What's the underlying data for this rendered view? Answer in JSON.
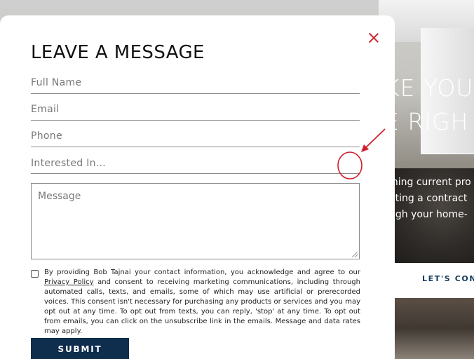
{
  "background": {
    "heading_line1": "KE YOU",
    "heading_line2": "E RIGH",
    "para_line1": "ining current pro",
    "para_line2": "ating a contract",
    "para_line3": "ugh your home-",
    "cta_link": "LET'S CONN"
  },
  "modal": {
    "title": "LEAVE A MESSAGE",
    "fields": {
      "full_name_placeholder": "Full Name",
      "email_placeholder": "Email",
      "phone_placeholder": "Phone",
      "interested_placeholder": "Interested In...",
      "message_placeholder": "Message"
    },
    "consent": {
      "text_before_link": "By providing Bob Tajnai your contact information, you acknowledge and agree to our ",
      "link_text": "Privacy Policy",
      "text_after_link": " and consent to receiving marketing communications, including through automated calls, texts, and emails, some of which may use artificial or prerecorded voices. This consent isn't necessary for purchasing any products or services and you may opt out at any time. To opt out from texts, you can reply, 'stop' at any time. To opt out from emails, you can click on the unsubscribe link in the emails. Message and data rates may apply."
    },
    "submit_label": "SUBMIT"
  },
  "colors": {
    "accent_red": "#d1202f",
    "button_navy": "#0f2d4d",
    "annotation_red": "#d41e2a"
  },
  "icons": {
    "close": "close-icon",
    "resize": "resize-grip-icon"
  }
}
